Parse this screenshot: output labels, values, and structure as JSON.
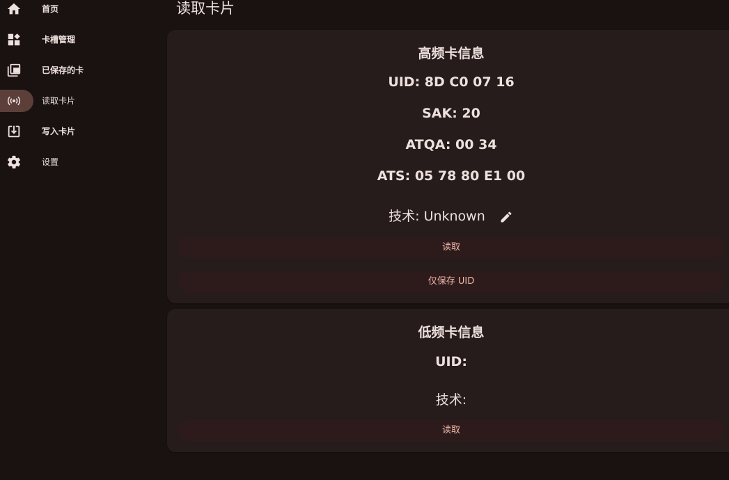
{
  "nav": {
    "items": [
      {
        "label": "首页",
        "icon": "home-icon"
      },
      {
        "label": "卡槽管理",
        "icon": "dashboard-customize-icon"
      },
      {
        "label": "已保存的卡",
        "icon": "library-copies-icon"
      },
      {
        "label": "读取卡片",
        "icon": "nfc-signal-icon",
        "active": true
      },
      {
        "label": "写入卡片",
        "icon": "download-box-icon"
      },
      {
        "label": "设置",
        "icon": "gear-icon"
      }
    ]
  },
  "page": {
    "title": "读取卡片"
  },
  "hf_card": {
    "title": "高频卡信息",
    "uid": "UID: 8D C0 07 16",
    "sak": "SAK: 20",
    "atqa": "ATQA: 00 34",
    "ats": "ATS: 05 78 80 E1 00",
    "tech": "技术: Unknown",
    "read_button": "读取",
    "save_uid_button": "仅保存 UID"
  },
  "lf_card": {
    "title": "低频卡信息",
    "uid": "UID:",
    "tech": "技术:",
    "read_button": "读取"
  },
  "colors": {
    "background": "#1a1211",
    "card": "#251c1b",
    "button_bg": "#2d1b1b",
    "button_text": "#f0b7aa",
    "active_pill": "#5d3f3a",
    "text": "#ede0dd"
  }
}
